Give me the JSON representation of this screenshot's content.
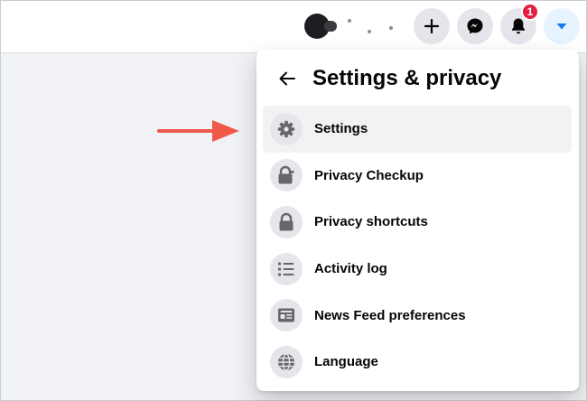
{
  "menu": {
    "title": "Settings & privacy",
    "items": [
      {
        "label": "Settings",
        "icon": "gear-icon"
      },
      {
        "label": "Privacy Checkup",
        "icon": "lock-heart-icon"
      },
      {
        "label": "Privacy shortcuts",
        "icon": "lock-icon"
      },
      {
        "label": "Activity log",
        "icon": "list-icon"
      },
      {
        "label": "News Feed preferences",
        "icon": "news-feed-icon"
      },
      {
        "label": "Language",
        "icon": "globe-icon"
      }
    ]
  },
  "header": {
    "notification_count": "1",
    "icons": [
      "plus-icon",
      "messenger-icon",
      "bell-icon",
      "caret-down-icon"
    ]
  },
  "colors": {
    "accent": "#1877f2",
    "badge": "#e41e3f",
    "annotation_arrow": "#f0594a"
  }
}
